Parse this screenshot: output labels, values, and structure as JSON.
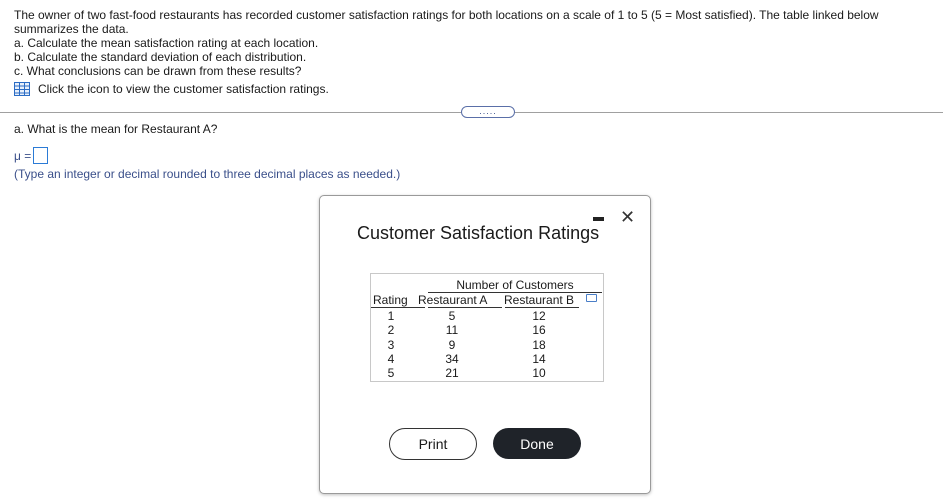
{
  "question": {
    "intro": "The owner of two fast-food restaurants has recorded customer satisfaction ratings for both locations on a scale of 1 to 5 (5 = Most satisfied). The table linked below summarizes the data.",
    "items": [
      "a. Calculate the mean satisfaction rating at each location.",
      "b. Calculate the standard deviation of each distribution.",
      "c. What conclusions can be drawn from these results?"
    ],
    "link_text": "Click the icon to view the customer satisfaction ratings.",
    "more_button": "....."
  },
  "part_a": {
    "prompt": "a. What is the mean for Restaurant A?",
    "mu_label": "μ =",
    "mu_value": "",
    "hint": "(Type an integer or decimal rounded to three decimal places as needed.)"
  },
  "dialog": {
    "title": "Customer Satisfaction Ratings",
    "table": {
      "group_header": "Number of Customers",
      "headers": [
        "Rating",
        "Restaurant A",
        "Restaurant B"
      ],
      "rows": [
        [
          "1",
          "5",
          "12"
        ],
        [
          "2",
          "11",
          "16"
        ],
        [
          "3",
          "9",
          "18"
        ],
        [
          "4",
          "34",
          "14"
        ],
        [
          "5",
          "21",
          "10"
        ]
      ]
    },
    "print_label": "Print",
    "done_label": "Done"
  }
}
